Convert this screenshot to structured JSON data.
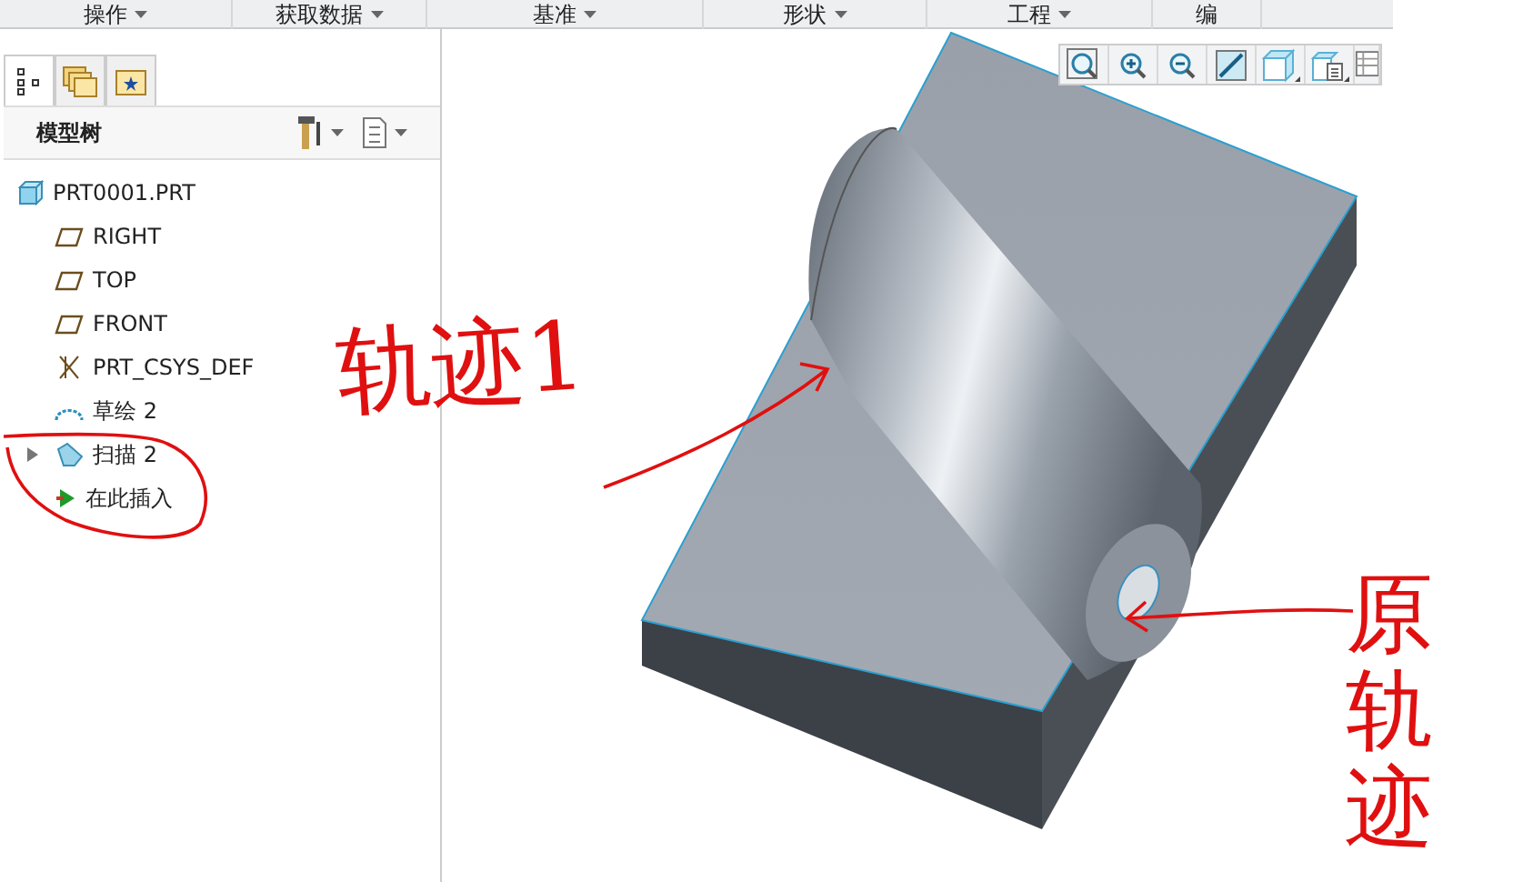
{
  "menu_bar": [
    {
      "label": "操作",
      "caret": true
    },
    {
      "label": "获取数据",
      "caret": true
    },
    {
      "label": "基准",
      "caret": true
    },
    {
      "label": "形状",
      "caret": true
    },
    {
      "label": "工程",
      "caret": true
    },
    {
      "label": "编",
      "caret": false
    }
  ],
  "panel_tabs": [
    {
      "kind": "tree",
      "selected": true
    },
    {
      "kind": "folders",
      "selected": false
    },
    {
      "kind": "favorites",
      "selected": false
    }
  ],
  "model_tree": {
    "title": "模型树",
    "items": [
      {
        "label": "PRT0001.PRT",
        "kind": "part"
      },
      {
        "label": "RIGHT",
        "kind": "plane"
      },
      {
        "label": "TOP",
        "kind": "plane"
      },
      {
        "label": "FRONT",
        "kind": "plane"
      },
      {
        "label": "PRT_CSYS_DEF",
        "kind": "csys"
      },
      {
        "label": "草绘 2",
        "kind": "sketch"
      },
      {
        "label": "扫描 2",
        "kind": "sweep",
        "expanded": false
      },
      {
        "label": "在此插入",
        "kind": "insert"
      }
    ]
  },
  "view_toolbar": [
    {
      "kind": "zoom-fit"
    },
    {
      "kind": "zoom-in"
    },
    {
      "kind": "zoom-out"
    },
    {
      "kind": "repaint"
    },
    {
      "kind": "display-style"
    },
    {
      "kind": "saved-views"
    },
    {
      "kind": "layers"
    }
  ],
  "annotations": [
    {
      "text": "轨迹1",
      "kind": "horizontal"
    },
    {
      "text": "原轨迹",
      "kind": "vertical"
    }
  ]
}
